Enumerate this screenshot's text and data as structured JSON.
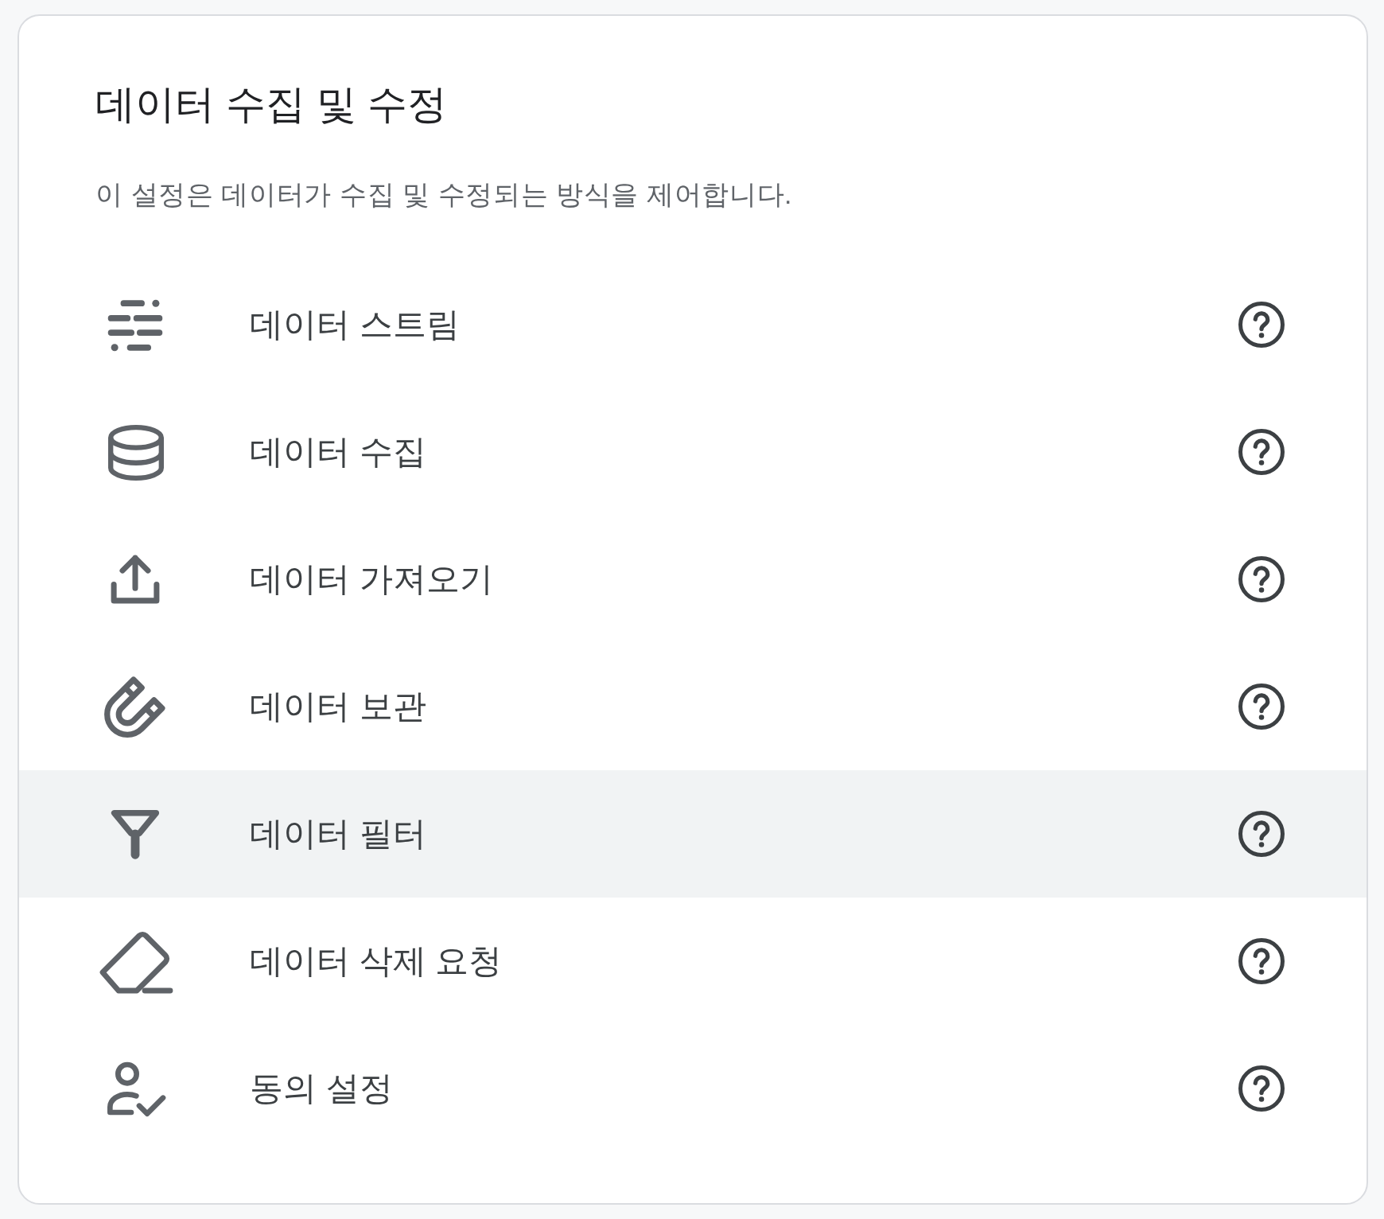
{
  "card": {
    "title": "데이터 수집 및 수정",
    "description": "이 설정은 데이터가 수집 및 수정되는 방식을 제어합니다."
  },
  "items": [
    {
      "label": "데이터 스트림",
      "selected": false
    },
    {
      "label": "데이터 수집",
      "selected": false
    },
    {
      "label": "데이터 가져오기",
      "selected": false
    },
    {
      "label": "데이터 보관",
      "selected": false
    },
    {
      "label": "데이터 필터",
      "selected": true
    },
    {
      "label": "데이터 삭제 요청",
      "selected": false
    },
    {
      "label": "동의 설정",
      "selected": false
    }
  ]
}
